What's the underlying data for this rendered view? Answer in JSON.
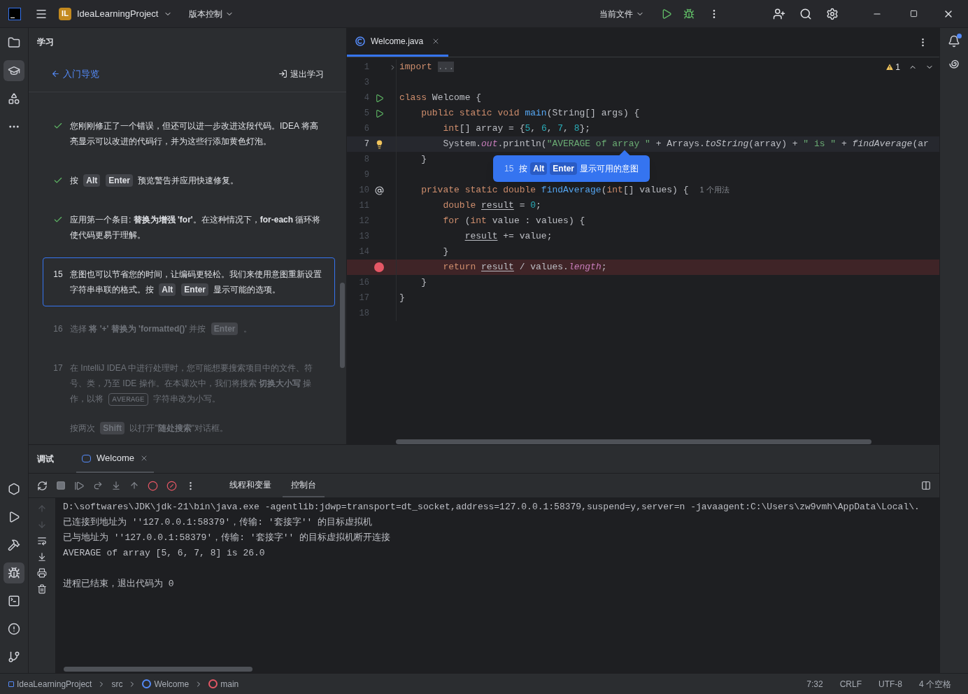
{
  "title_bar": {
    "project_badge": "IL",
    "project_name": "IdeaLearningProject",
    "vcs_menu": "版本控制",
    "run_config": "当前文件"
  },
  "left_stripe": {
    "top": [
      {
        "kind": "project",
        "selected": false
      },
      {
        "kind": "learn",
        "selected": true
      },
      {
        "kind": "structure",
        "selected": false
      },
      {
        "kind": "more",
        "selected": false
      }
    ],
    "bottom": [
      {
        "kind": "services",
        "selected": false
      },
      {
        "kind": "run",
        "selected": false
      },
      {
        "kind": "build",
        "selected": false
      },
      {
        "kind": "debug",
        "selected": true
      },
      {
        "kind": "terminal",
        "selected": false
      },
      {
        "kind": "problems",
        "selected": false
      },
      {
        "kind": "git",
        "selected": false
      }
    ]
  },
  "right_stripe": {
    "notification_unread": true
  },
  "learn_panel": {
    "title": "学习",
    "back_link": "入门导览",
    "exit_button": "退出学习",
    "steps": [
      {
        "kind": "done",
        "paragraphs": [
          [
            {
              "kind": "text",
              "t": "您刚刚修正了一个错误，但还可以进一步改进这段代码。IDEA 将高亮显示可以改进的代码行，并为这些行添加黄色灯泡。"
            }
          ]
        ]
      },
      {
        "kind": "done",
        "paragraphs": [
          [
            {
              "kind": "text",
              "t": "按"
            },
            {
              "kind": "key",
              "t": "Alt"
            },
            {
              "kind": "key",
              "t": "Enter"
            },
            {
              "kind": "text",
              "t": "预览警告并应用快速修复。"
            }
          ]
        ]
      },
      {
        "kind": "done",
        "paragraphs": [
          [
            {
              "kind": "text",
              "t": "应用第一个条目: **替换为增强 'for'**。在这种情况下，**for-each** 循环将使代码更易于理解。"
            }
          ]
        ]
      },
      {
        "kind": "current",
        "number": "15",
        "paragraphs": [
          [
            {
              "kind": "text",
              "t": "意图也可以节省您的时间，让编码更轻松。我们来使用意图重新设置字符串串联的格式。按"
            },
            {
              "kind": "key",
              "t": "Alt"
            },
            {
              "kind": "key",
              "t": "Enter"
            },
            {
              "kind": "text",
              "t": "显示可能的选项。"
            }
          ]
        ]
      },
      {
        "kind": "pending",
        "number": "16",
        "paragraphs": [
          [
            {
              "kind": "text",
              "t": "选择 **将 '+' 替换为 'formatted()'** 并按"
            },
            {
              "kind": "key",
              "t": "Enter"
            },
            {
              "kind": "text",
              "t": "。"
            }
          ]
        ]
      },
      {
        "kind": "pending",
        "number": "17",
        "paragraphs": [
          [
            {
              "kind": "text",
              "t": "在 IntelliJ IDEA 中进行处理时，您可能想要搜索项目中的文件、符号、类，乃至 IDE 操作。在本课次中，我们将搜索 **切换大小写** 操作，以将"
            },
            {
              "kind": "code",
              "t": "AVERAGE"
            },
            {
              "kind": "text",
              "t": "字符串改为小写。"
            }
          ],
          [
            {
              "kind": "text",
              "t": "按两次"
            },
            {
              "kind": "key",
              "t": "Shift"
            },
            {
              "kind": "text",
              "t": "以打开\"**随处搜索**\"对话框。"
            }
          ]
        ]
      }
    ]
  },
  "editor": {
    "tab": {
      "label": "Welcome.java",
      "selected": true
    },
    "warnings": "1",
    "lines": [
      {
        "number": "1",
        "folded": true,
        "current": false,
        "breakpoint": false,
        "tokens": [
          {
            "kind": "kw",
            "t": "import"
          },
          {
            "kind": "fold",
            "t": "..."
          }
        ]
      },
      {
        "number": "3",
        "folded": false,
        "current": false,
        "breakpoint": false
      },
      {
        "number": "4",
        "folded": false,
        "current": false,
        "breakpoint": false,
        "gutter": {
          "kind": "run"
        },
        "tokens": [
          {
            "kind": "kw",
            "t": "class"
          },
          {
            "kind": "plain",
            "t": " Welcome {"
          }
        ]
      },
      {
        "number": "5",
        "folded": false,
        "current": false,
        "breakpoint": false,
        "gutter": {
          "kind": "run"
        },
        "tokens": [
          {
            "kind": "kw",
            "t": "    public static void "
          },
          {
            "kind": "decl",
            "t": "main"
          },
          {
            "kind": "plain",
            "t": "(String[] args) {"
          }
        ]
      },
      {
        "number": "6",
        "folded": false,
        "current": false,
        "breakpoint": false,
        "tokens": [
          {
            "kind": "kw",
            "t": "        int"
          },
          {
            "kind": "plain",
            "t": "[] array = {"
          },
          {
            "kind": "num",
            "t": "5"
          },
          {
            "kind": "plain",
            "t": ", "
          },
          {
            "kind": "num",
            "t": "6"
          },
          {
            "kind": "plain",
            "t": ", "
          },
          {
            "kind": "num",
            "t": "7"
          },
          {
            "kind": "plain",
            "t": ", "
          },
          {
            "kind": "num",
            "t": "8"
          },
          {
            "kind": "plain",
            "t": "};"
          }
        ]
      },
      {
        "number": "7",
        "folded": false,
        "current": true,
        "breakpoint": false,
        "gutter": {
          "kind": "bulb"
        },
        "tokens": [
          {
            "kind": "plain",
            "t": "        System."
          },
          {
            "kind": "static_field",
            "t": "out"
          },
          {
            "kind": "plain",
            "t": ".println("
          },
          {
            "kind": "str",
            "t": "\"AVERAGE of array \""
          },
          {
            "kind": "plain",
            "t": " + Arrays."
          },
          {
            "kind": "static_call",
            "t": "toString"
          },
          {
            "kind": "plain",
            "t": "(array) + "
          },
          {
            "kind": "str",
            "t": "\" is \""
          },
          {
            "kind": "plain",
            "t": " + "
          },
          {
            "kind": "static_call",
            "t": "findAverage"
          },
          {
            "kind": "plain",
            "t": "(ar"
          }
        ]
      },
      {
        "number": "8",
        "folded": false,
        "current": false,
        "breakpoint": false,
        "tokens": [
          {
            "kind": "plain",
            "t": "    }"
          }
        ]
      },
      {
        "number": "9",
        "folded": false,
        "current": false,
        "breakpoint": false
      },
      {
        "number": "10",
        "folded": false,
        "current": false,
        "breakpoint": false,
        "gutter": {
          "kind": "at"
        },
        "hint": "1 个用法",
        "tokens": [
          {
            "kind": "kw",
            "t": "    private static double "
          },
          {
            "kind": "decl",
            "t": "findAverage"
          },
          {
            "kind": "plain",
            "t": "("
          },
          {
            "kind": "kw",
            "t": "int"
          },
          {
            "kind": "plain",
            "t": "[] values) {"
          }
        ]
      },
      {
        "number": "11",
        "folded": false,
        "current": false,
        "breakpoint": false,
        "tokens": [
          {
            "kind": "kw",
            "t": "        double "
          },
          {
            "kind": "var",
            "t": "result"
          },
          {
            "kind": "plain",
            "t": " = "
          },
          {
            "kind": "num",
            "t": "0"
          },
          {
            "kind": "plain",
            "t": ";"
          }
        ]
      },
      {
        "number": "12",
        "folded": false,
        "current": false,
        "breakpoint": false,
        "tokens": [
          {
            "kind": "kw",
            "t": "        for "
          },
          {
            "kind": "plain",
            "t": "("
          },
          {
            "kind": "kw",
            "t": "int"
          },
          {
            "kind": "plain",
            "t": " value : values) {"
          }
        ]
      },
      {
        "number": "13",
        "folded": false,
        "current": false,
        "breakpoint": false,
        "tokens": [
          {
            "kind": "var",
            "t": "            result"
          },
          {
            "kind": "plain",
            "t": " += value;"
          }
        ]
      },
      {
        "number": "14",
        "folded": false,
        "current": false,
        "breakpoint": false,
        "tokens": [
          {
            "kind": "plain",
            "t": "        }"
          }
        ]
      },
      {
        "folded": false,
        "current": false,
        "breakpoint": true,
        "tokens": [
          {
            "kind": "kw",
            "t": "        return "
          },
          {
            "kind": "var",
            "t": "result"
          },
          {
            "kind": "plain",
            "t": " / values."
          },
          {
            "kind": "static_field",
            "t": "length"
          },
          {
            "kind": "plain",
            "t": ";"
          }
        ]
      },
      {
        "number": "16",
        "folded": false,
        "current": false,
        "breakpoint": false,
        "tokens": [
          {
            "kind": "plain",
            "t": "    }"
          }
        ]
      },
      {
        "number": "17",
        "folded": false,
        "current": false,
        "breakpoint": false,
        "tokens": [
          {
            "kind": "plain",
            "t": "}"
          }
        ]
      },
      {
        "number": "18",
        "folded": false,
        "current": false,
        "breakpoint": false
      }
    ],
    "tooltip": {
      "number": "15",
      "parts": [
        {
          "kind": "text",
          "t": "按"
        },
        {
          "kind": "key",
          "t": "Alt"
        },
        {
          "kind": "key",
          "t": "Enter"
        },
        {
          "kind": "text",
          "t": "显示可用的意图"
        }
      ]
    }
  },
  "debug_panel": {
    "title": "调试",
    "session_tabs": [
      {
        "label": "Welcome",
        "selected": true
      }
    ],
    "view_tabs": [
      {
        "label": "线程和变量",
        "selected": false
      },
      {
        "label": "控制台",
        "selected": true
      }
    ],
    "console": {
      "output": [
        "D:\\softwares\\JDK\\jdk-21\\bin\\java.exe -agentlib:jdwp=transport=dt_socket,address=127.0.0.1:58379,suspend=y,server=n -javaagent:C:\\Users\\zw9vmh\\AppData\\Local\\.",
        "已连接到地址为 ''127.0.0.1:58379'，传输: '套接字'' 的目标虚拟机",
        "已与地址为 ''127.0.0.1:58379'，传输: '套接字'' 的目标虚拟机断开连接",
        "AVERAGE of array [5, 6, 7, 8] is 26.0"
      ],
      "exit_message": "进程已结束，退出代码为 0"
    }
  },
  "status_bar": {
    "breadcrumbs": [
      {
        "kind": "module",
        "label": "IdeaLearningProject"
      },
      {
        "kind": "folder",
        "label": "src"
      },
      {
        "kind": "class",
        "label": "Welcome"
      },
      {
        "kind": "method",
        "label": "main"
      }
    ],
    "caret": "7:32",
    "line_ending": "CRLF",
    "encoding": "UTF-8",
    "indent": "4 个空格"
  }
}
